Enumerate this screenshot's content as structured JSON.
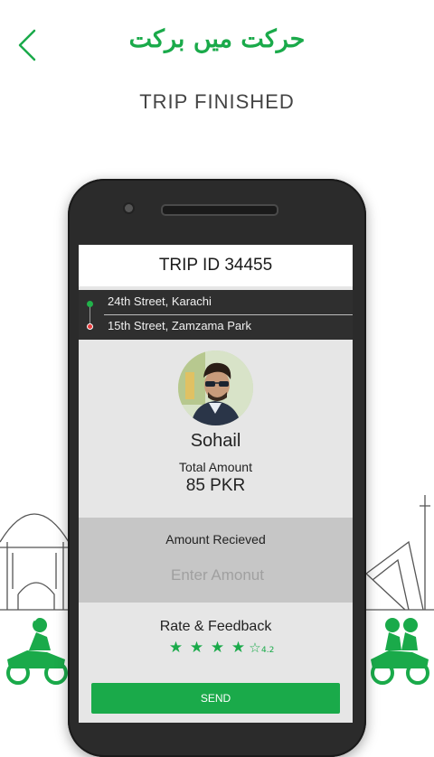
{
  "header": {
    "urdu_title": "حرکت میں برکت",
    "subtitle": "TRIP FINISHED"
  },
  "trip": {
    "title": "TRIP ID 34455",
    "pickup": "24th Street, Karachi",
    "dropoff": "15th Street, Zamzama Park"
  },
  "driver": {
    "name": "Sohail",
    "total_label": "Total Amount",
    "total_value": "85 PKR"
  },
  "payment": {
    "received_label": "Amount Recieved",
    "placeholder": "Enter Amonut"
  },
  "feedback": {
    "label": "Rate & Feedback",
    "filled_stars": 4,
    "total_stars": 5,
    "rating": "4.2",
    "send_label": "SEND"
  },
  "colors": {
    "brand_green": "#1aaa4a",
    "dark_bar": "#2f2f2f",
    "pickup_dot": "#21b24a",
    "dropoff_dot": "#e83c3c"
  },
  "icons": {
    "back": "chevron-left-icon",
    "pickup": "green-dot-icon",
    "dropoff": "red-dot-icon",
    "star_full": "★",
    "star_empty": "☆"
  }
}
